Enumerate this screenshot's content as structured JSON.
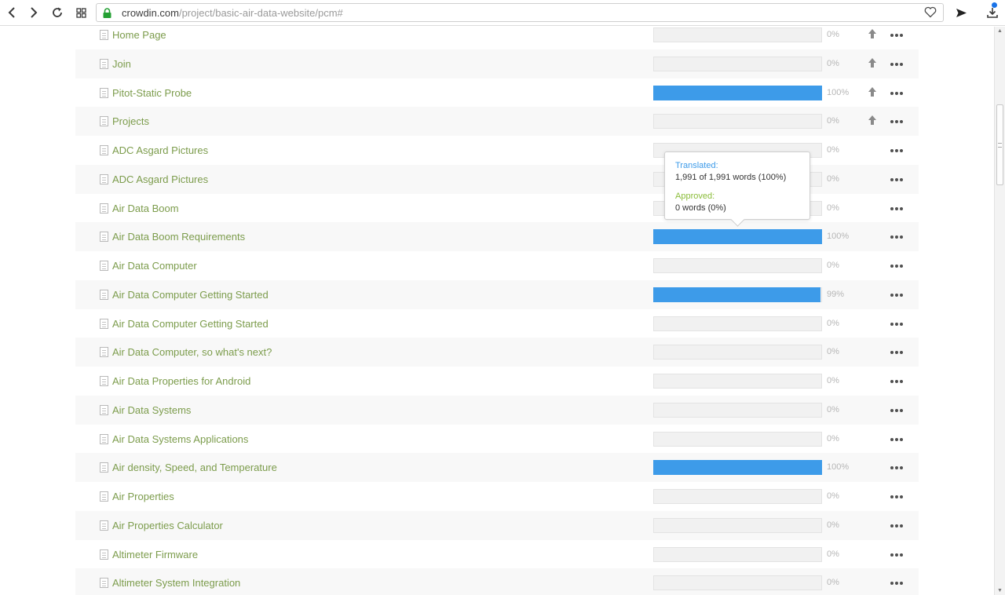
{
  "browser": {
    "url_domain": "crowdin.com",
    "url_path": "/project/basic-air-data-website/pcm#",
    "nav": {
      "back_icon": "back-icon",
      "forward_icon": "forward-icon",
      "reload_icon": "reload-icon",
      "tabs_icon": "tab-grid-icon"
    },
    "colors": {
      "lock": "#24a033",
      "download_badge": "#1a73e8"
    }
  },
  "files": [
    {
      "name": "Home Page",
      "percent": "0%",
      "progress": 0,
      "upload": true
    },
    {
      "name": "Join",
      "percent": "0%",
      "progress": 0,
      "upload": true
    },
    {
      "name": "Pitot-Static Probe",
      "percent": "100%",
      "progress": 100,
      "upload": true
    },
    {
      "name": "Projects",
      "percent": "0%",
      "progress": 0,
      "upload": true
    },
    {
      "name": "ADC Asgard Pictures",
      "percent": "0%",
      "progress": 0,
      "upload": false
    },
    {
      "name": "ADC Asgard Pictures",
      "percent": "0%",
      "progress": 0,
      "upload": false
    },
    {
      "name": "Air Data Boom",
      "percent": "0%",
      "progress": 0,
      "upload": false
    },
    {
      "name": "Air Data Boom Requirements",
      "percent": "100%",
      "progress": 100,
      "upload": false
    },
    {
      "name": "Air Data Computer",
      "percent": "0%",
      "progress": 0,
      "upload": false
    },
    {
      "name": "Air Data Computer Getting Started",
      "percent": "99%",
      "progress": 99,
      "upload": false
    },
    {
      "name": "Air Data Computer Getting Started",
      "percent": "0%",
      "progress": 0,
      "upload": false
    },
    {
      "name": "Air Data Computer, so what's next?",
      "percent": "0%",
      "progress": 0,
      "upload": false
    },
    {
      "name": "Air Data Properties for Android",
      "percent": "0%",
      "progress": 0,
      "upload": false
    },
    {
      "name": "Air Data Systems",
      "percent": "0%",
      "progress": 0,
      "upload": false
    },
    {
      "name": "Air Data Systems Applications",
      "percent": "0%",
      "progress": 0,
      "upload": false
    },
    {
      "name": "Air density, Speed, and Temperature",
      "percent": "100%",
      "progress": 100,
      "upload": false
    },
    {
      "name": "Air Properties",
      "percent": "0%",
      "progress": 0,
      "upload": false
    },
    {
      "name": "Air Properties Calculator",
      "percent": "0%",
      "progress": 0,
      "upload": false
    },
    {
      "name": "Altimeter Firmware",
      "percent": "0%",
      "progress": 0,
      "upload": false
    },
    {
      "name": "Altimeter System Integration",
      "percent": "0%",
      "progress": 0,
      "upload": false
    }
  ],
  "tooltip": {
    "translated_label": "Translated:",
    "translated_value": "1,991 of 1,991 words (100%)",
    "approved_label": "Approved:",
    "approved_value": "0 words (0%)",
    "colors": {
      "translated": "#3d9be9",
      "approved": "#8bbd3a"
    }
  },
  "colors": {
    "file_name": "#7c9c4c",
    "progress_fill": "#3d9be9",
    "progress_empty": "#f1f1f1"
  }
}
